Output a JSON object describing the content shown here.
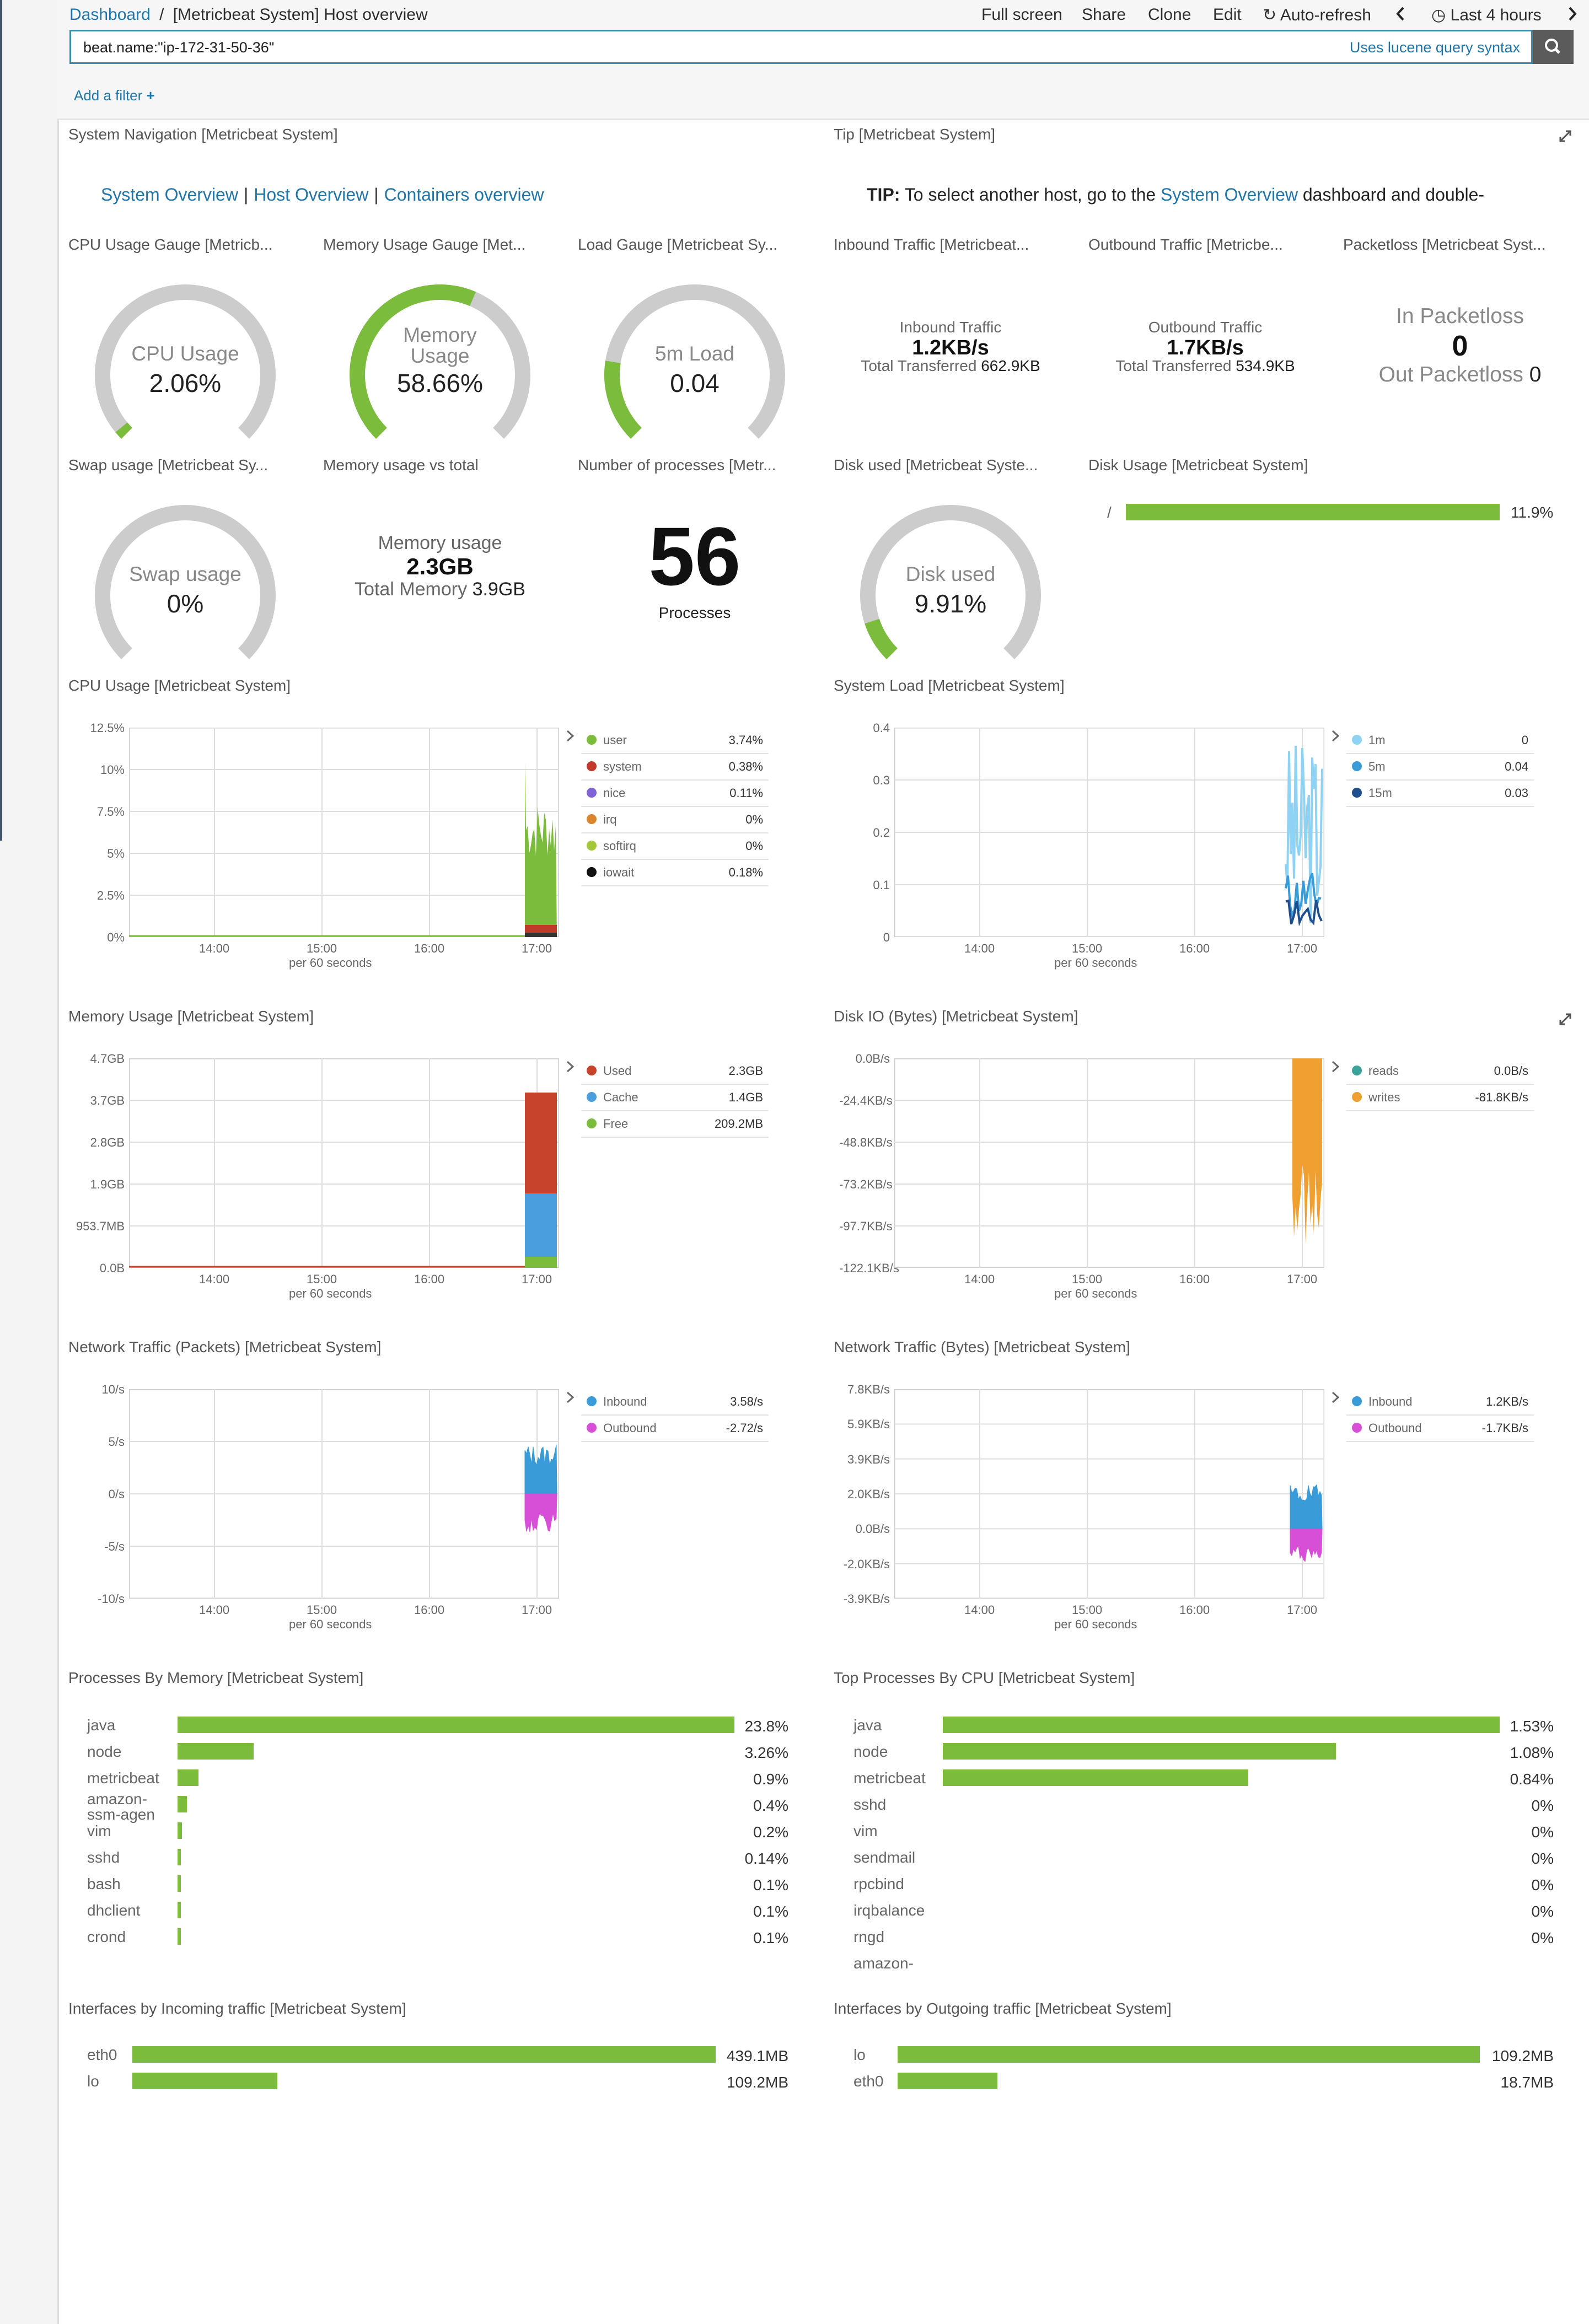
{
  "header": {
    "breadcrumb_root": "Dashboard",
    "breadcrumb_sep": "/",
    "title": "[Metricbeat System] Host overview",
    "menu": [
      "Full screen",
      "Share",
      "Clone",
      "Edit",
      "Auto-refresh",
      "Last 4 hours"
    ],
    "query": "beat.name:\"ip-172-31-50-36\"",
    "query_hint": "Uses lucene query syntax",
    "add_filter": "Add a filter"
  },
  "nav_panel": {
    "title": "System Navigation [Metricbeat System]",
    "links": [
      "System Overview",
      "Host Overview",
      "Containers overview"
    ]
  },
  "tip_panel": {
    "title": "Tip [Metricbeat System]",
    "tip_label": "TIP:",
    "tip_text_1": "To select another host, go to the",
    "tip_link": "System Overview",
    "tip_text_2": "dashboard and double-"
  },
  "gauges": {
    "cpu": {
      "title": "CPU Usage Gauge [Metricb...",
      "label": "CPU Usage",
      "value": "2.06%",
      "fraction": 0.0206
    },
    "memory": {
      "title": "Memory Usage Gauge [Met...",
      "label_1": "Memory",
      "label_2": "Usage",
      "value": "58.66%",
      "fraction": 0.5866
    },
    "load": {
      "title": "Load Gauge [Metricbeat Sy...",
      "label": "5m Load",
      "value": "0.04",
      "fraction": 0.2
    },
    "swap": {
      "title": "Swap usage [Metricbeat Sy...",
      "label": "Swap usage",
      "value": "0%",
      "fraction": 0
    },
    "disk": {
      "title": "Disk used [Metricbeat Syste...",
      "label": "Disk used",
      "value": "9.91%",
      "fraction": 0.0991
    }
  },
  "traffic": {
    "inbound": {
      "title": "Inbound Traffic [Metricbeat...",
      "label": "Inbound Traffic",
      "value": "1.2KB/s",
      "total_label": "Total Transferred",
      "total": "662.9KB"
    },
    "outbound": {
      "title": "Outbound Traffic [Metricbe...",
      "label": "Outbound Traffic",
      "value": "1.7KB/s",
      "total_label": "Total Transferred",
      "total": "534.9KB"
    }
  },
  "packetloss": {
    "title": "Packetloss [Metricbeat Syst...",
    "in_label": "In Packetloss",
    "in_value": "0",
    "out_label": "Out Packetloss",
    "out_value": "0"
  },
  "memory_total": {
    "title": "Memory usage vs total",
    "label": "Memory usage",
    "value": "2.3GB",
    "total_label": "Total Memory",
    "total": "3.9GB"
  },
  "processes": {
    "title": "Number of processes [Metr...",
    "value": "56",
    "label": "Processes"
  },
  "disk_usage": {
    "title": "Disk Usage [Metricbeat System]",
    "mount": "/",
    "value": "11.9%",
    "fraction": 0.119
  },
  "cpu_chart": {
    "title": "CPU Usage [Metricbeat System]",
    "x_caption": "per 60 seconds",
    "y_ticks": [
      "12.5%",
      "10%",
      "7.5%",
      "5%",
      "2.5%",
      "0%"
    ],
    "x_ticks": [
      "14:00",
      "15:00",
      "16:00",
      "17:00"
    ],
    "legend": [
      {
        "name": "user",
        "value": "3.74%",
        "color": "#7cbc3d"
      },
      {
        "name": "system",
        "value": "0.38%",
        "color": "#c0392b"
      },
      {
        "name": "nice",
        "value": "0.11%",
        "color": "#7e62d6"
      },
      {
        "name": "irq",
        "value": "0%",
        "color": "#d9852d"
      },
      {
        "name": "softirq",
        "value": "0%",
        "color": "#a4c639"
      },
      {
        "name": "iowait",
        "value": "0.18%",
        "color": "#111111"
      }
    ]
  },
  "load_chart": {
    "title": "System Load [Metricbeat System]",
    "x_caption": "per 60 seconds",
    "y_ticks": [
      "0.4",
      "0.3",
      "0.2",
      "0.1",
      "0"
    ],
    "x_ticks": [
      "14:00",
      "15:00",
      "16:00",
      "17:00"
    ],
    "legend": [
      {
        "name": "1m",
        "value": "0",
        "color": "#8fd3f4"
      },
      {
        "name": "5m",
        "value": "0.04",
        "color": "#3a9bd9"
      },
      {
        "name": "15m",
        "value": "0.03",
        "color": "#1f4e8c"
      }
    ]
  },
  "memory_chart": {
    "title": "Memory Usage [Metricbeat System]",
    "x_caption": "per 60 seconds",
    "y_ticks": [
      "4.7GB",
      "3.7GB",
      "2.8GB",
      "1.9GB",
      "953.7MB",
      "0.0B"
    ],
    "x_ticks": [
      "14:00",
      "15:00",
      "16:00",
      "17:00"
    ],
    "legend": [
      {
        "name": "Used",
        "value": "2.3GB",
        "color": "#c8432b"
      },
      {
        "name": "Cache",
        "value": "1.4GB",
        "color": "#4a9ede"
      },
      {
        "name": "Free",
        "value": "209.2MB",
        "color": "#7cbc3d"
      }
    ]
  },
  "diskio_chart": {
    "title": "Disk IO (Bytes) [Metricbeat System]",
    "x_caption": "per 60 seconds",
    "y_ticks": [
      "0.0B/s",
      "-24.4KB/s",
      "-48.8KB/s",
      "-73.2KB/s",
      "-97.7KB/s",
      "-122.1KB/s"
    ],
    "x_ticks": [
      "14:00",
      "15:00",
      "16:00",
      "17:00"
    ],
    "legend": [
      {
        "name": "reads",
        "value": "0.0B/s",
        "color": "#3aa39a"
      },
      {
        "name": "writes",
        "value": "-81.8KB/s",
        "color": "#f0a030"
      }
    ]
  },
  "netpackets_chart": {
    "title": "Network Traffic (Packets) [Metricbeat System]",
    "x_caption": "per 60 seconds",
    "y_ticks": [
      "10/s",
      "5/s",
      "0/s",
      "-5/s",
      "-10/s"
    ],
    "x_ticks": [
      "14:00",
      "15:00",
      "16:00",
      "17:00"
    ],
    "legend": [
      {
        "name": "Inbound",
        "value": "3.58/s",
        "color": "#3a9bd9"
      },
      {
        "name": "Outbound",
        "value": "-2.72/s",
        "color": "#d64fd6"
      }
    ]
  },
  "netbytes_chart": {
    "title": "Network Traffic (Bytes) [Metricbeat System]",
    "x_caption": "per 60 seconds",
    "y_ticks": [
      "7.8KB/s",
      "5.9KB/s",
      "3.9KB/s",
      "2.0KB/s",
      "0.0B/s",
      "-2.0KB/s",
      "-3.9KB/s"
    ],
    "x_ticks": [
      "14:00",
      "15:00",
      "16:00",
      "17:00"
    ],
    "legend": [
      {
        "name": "Inbound",
        "value": "1.2KB/s",
        "color": "#3a9bd9"
      },
      {
        "name": "Outbound",
        "value": "-1.7KB/s",
        "color": "#d64fd6"
      }
    ]
  },
  "proc_memory": {
    "title": "Processes By Memory [Metricbeat System]",
    "rows": [
      {
        "name": "java",
        "value": "23.8%",
        "fraction": 1.0
      },
      {
        "name": "node",
        "value": "3.26%",
        "fraction": 0.137
      },
      {
        "name": "metricbeat",
        "value": "0.9%",
        "fraction": 0.038
      },
      {
        "name_1": "amazon-",
        "name_2": "ssm-agen",
        "value": "0.4%",
        "fraction": 0.017
      },
      {
        "name": "vim",
        "value": "0.2%",
        "fraction": 0.008
      },
      {
        "name": "sshd",
        "value": "0.14%",
        "fraction": 0.006
      },
      {
        "name": "bash",
        "value": "0.1%",
        "fraction": 0.004
      },
      {
        "name": "dhclient",
        "value": "0.1%",
        "fraction": 0.004
      },
      {
        "name": "crond",
        "value": "0.1%",
        "fraction": 0.004
      }
    ]
  },
  "proc_cpu": {
    "title": "Top Processes By CPU [Metricbeat System]",
    "rows": [
      {
        "name": "java",
        "value": "1.53%",
        "fraction": 1.0
      },
      {
        "name": "node",
        "value": "1.08%",
        "fraction": 0.706
      },
      {
        "name": "metricbeat",
        "value": "0.84%",
        "fraction": 0.549
      },
      {
        "name": "sshd",
        "value": "0%",
        "fraction": 0
      },
      {
        "name": "vim",
        "value": "0%",
        "fraction": 0
      },
      {
        "name": "sendmail",
        "value": "0%",
        "fraction": 0
      },
      {
        "name": "rpcbind",
        "value": "0%",
        "fraction": 0
      },
      {
        "name": "irqbalance",
        "value": "0%",
        "fraction": 0
      },
      {
        "name": "rngd",
        "value": "0%",
        "fraction": 0
      },
      {
        "name": "amazon-",
        "value": "",
        "fraction": 0
      }
    ]
  },
  "if_incoming": {
    "title": "Interfaces by Incoming traffic [Metricbeat System]",
    "rows": [
      {
        "name": "eth0",
        "value": "439.1MB",
        "fraction": 1.0
      },
      {
        "name": "lo",
        "value": "109.2MB",
        "fraction": 0.249
      }
    ]
  },
  "if_outgoing": {
    "title": "Interfaces by Outgoing traffic [Metricbeat System]",
    "rows": [
      {
        "name": "lo",
        "value": "109.2MB",
        "fraction": 1.0
      },
      {
        "name": "eth0",
        "value": "18.7MB",
        "fraction": 0.171
      }
    ]
  },
  "colors": {
    "accent": "#1f74a8",
    "bar_green": "#7cbc3d",
    "gauge_track": "#cccccc"
  }
}
